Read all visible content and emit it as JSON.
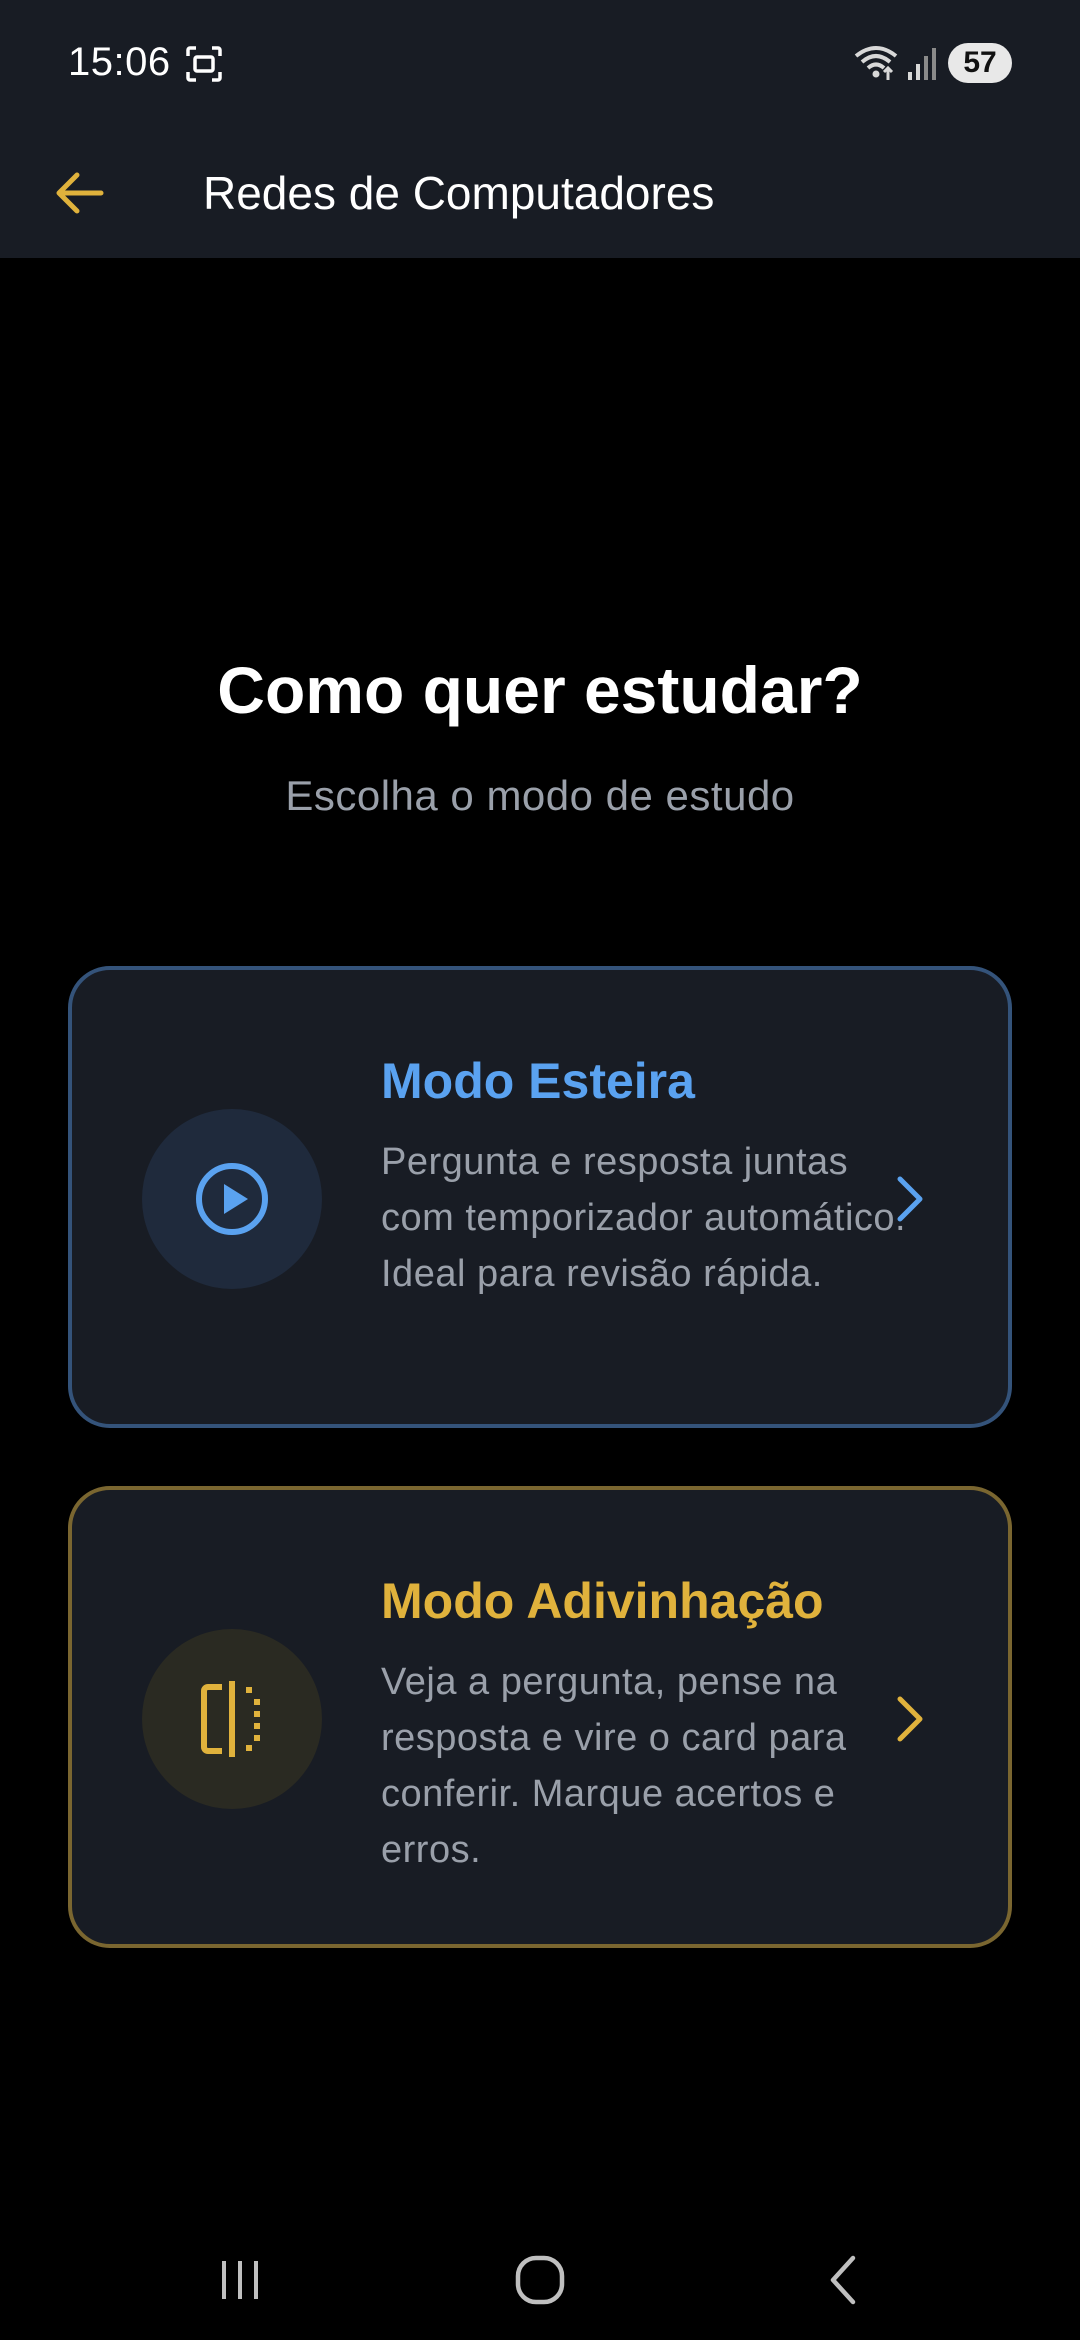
{
  "status_bar": {
    "time": "15:06",
    "battery": "57"
  },
  "app_bar": {
    "title": "Redes de Computadores"
  },
  "main": {
    "heading": "Como quer estudar?",
    "subheading": "Escolha o modo de estudo"
  },
  "modes": [
    {
      "title": "Modo Esteira",
      "description": "Pergunta e resposta juntas com temporizador automático. Ideal para revisão rápida.",
      "icon": "play-circle-icon",
      "accent": "#5aa2f0"
    },
    {
      "title": "Modo Adivinhação",
      "description": "Veja a pergunta, pense na resposta e vire o card para conferir. Marque acertos e erros.",
      "icon": "flip-icon",
      "accent": "#e0b23c"
    }
  ],
  "colors": {
    "app_bar_bg": "#181c24",
    "background": "#000000",
    "back_arrow": "#e0b23c",
    "muted_text": "#9aa0aa"
  }
}
